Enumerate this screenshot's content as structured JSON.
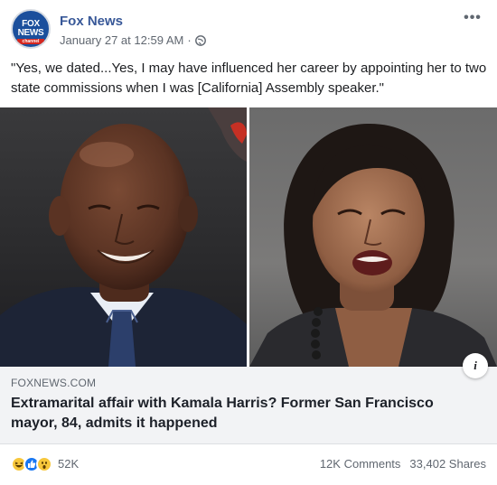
{
  "post": {
    "page_name": "Fox News",
    "timestamp": "January 27 at 12:59 AM",
    "separator": "·",
    "avatar": {
      "line1": "FOX",
      "line2": "NEWS",
      "line3": "channel"
    },
    "more_label": "•••",
    "text": "\"Yes, we dated...Yes, I may have influenced her career by appointing her to two state commissions when I was [California] Assembly speaker.\""
  },
  "link": {
    "domain": "FOXNEWS.COM",
    "headline": "Extramarital affair with Kamala Harris? Former San Francisco mayor, 84, admits it happened",
    "info_label": "i"
  },
  "footer": {
    "reactions_count": "52K",
    "comments": "12K Comments",
    "shares": "33,402 Shares"
  },
  "colors": {
    "page_name": "#385898",
    "link_bg": "#f2f3f5",
    "like_blue": "#1877f2",
    "emoji_yellow": "#f7c73b",
    "fox_blue": "#1b4f9c",
    "fox_red": "#d5271f"
  },
  "icons": {
    "globe": "globe-icon",
    "more": "more-options-icon",
    "info": "info-icon",
    "haha": "haha-reaction-icon",
    "like": "like-reaction-icon",
    "wow": "wow-reaction-icon"
  }
}
